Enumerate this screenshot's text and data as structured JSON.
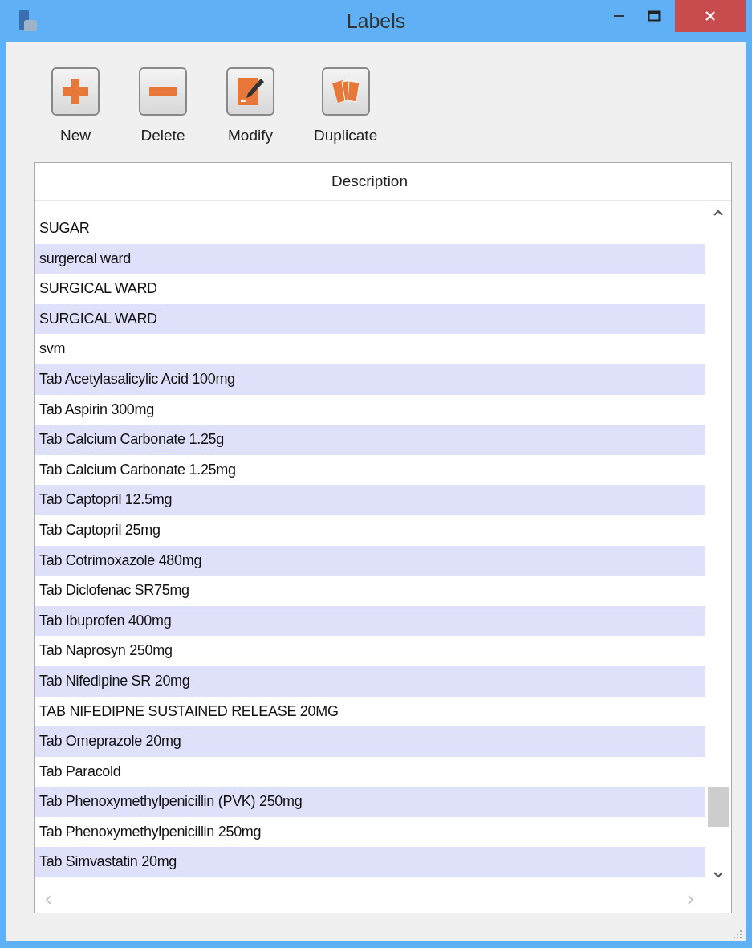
{
  "window": {
    "title": "Labels"
  },
  "toolbar": [
    {
      "label": "New",
      "kind": "new"
    },
    {
      "label": "Delete",
      "kind": "delete"
    },
    {
      "label": "Modify",
      "kind": "modify"
    },
    {
      "label": "Duplicate",
      "kind": "duplicate"
    }
  ],
  "table": {
    "columns": [
      "Description"
    ],
    "rows": [
      "SUGAR",
      "surgercal ward",
      "SURGICAL WARD",
      "SURGICAL WARD",
      "svm",
      "Tab Acetylasalicylic Acid 100mg",
      "Tab Aspirin 300mg",
      "Tab Calcium Carbonate 1.25g",
      "Tab Calcium Carbonate 1.25mg",
      "Tab Captopril 12.5mg",
      "Tab Captopril 25mg",
      "Tab Cotrimoxazole 480mg",
      "Tab Diclofenac SR75mg",
      "Tab Ibuprofen 400mg",
      "Tab Naprosyn 250mg",
      "Tab Nifedipine SR 20mg",
      "TAB NIFEDIPNE SUSTAINED RELEASE 20MG",
      "Tab Omeprazole 20mg",
      "Tab Paracold",
      "Tab Phenoxymethylpenicillin (PVK) 250mg",
      "Tab Phenoxymethylpenicillin 250mg",
      "Tab Simvastatin 20mg"
    ]
  }
}
